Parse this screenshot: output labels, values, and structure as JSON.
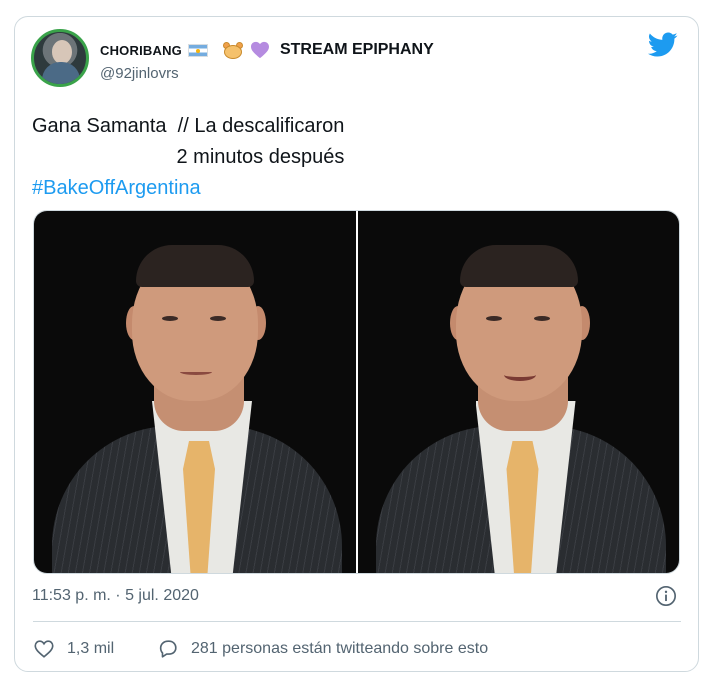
{
  "user": {
    "display_name_part1": "CHORIBANG",
    "display_name_part2": "STREAM EPIPHANY",
    "handle": "@92jinlovrs",
    "avatar_icon": "profile-photo",
    "emoji_icons": [
      "argentina-flag-icon",
      "hamster-icon",
      "purple-heart-icon"
    ]
  },
  "tweet": {
    "line1": "Gana Samanta  // La descalificaron",
    "line2": "                          2 minutos después",
    "hashtag": "#BakeOffArgentina",
    "timestamp": "11:53 p. m. · 5 jul. 2020"
  },
  "actions": {
    "like_count": "1,3 mil",
    "reply_text": "281 personas están twitteando sobre esto"
  },
  "colors": {
    "accent": "#1d9bf0",
    "text": "#0f1419",
    "secondary": "#536471",
    "border": "#cfd9de"
  }
}
